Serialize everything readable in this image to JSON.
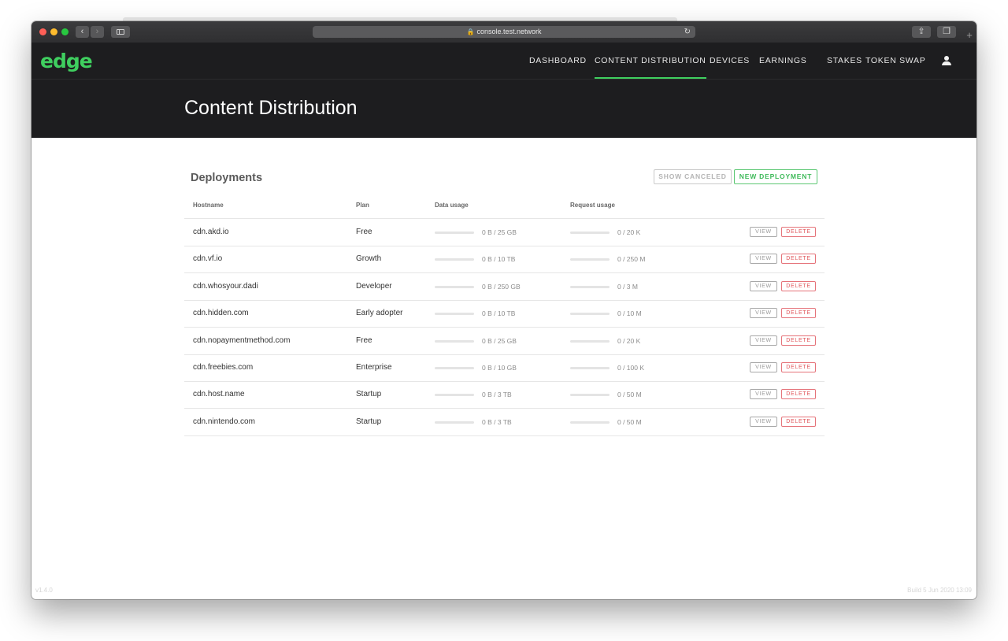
{
  "browser": {
    "url": "console.test.network",
    "back_glyph": "‹",
    "forward_glyph": "›",
    "share_glyph": "⇪",
    "tabs_glyph": "❐",
    "plus_glyph": "+",
    "reload_glyph": "↻",
    "lock_glyph": "🔒"
  },
  "app": {
    "logo": "edge",
    "accent_color": "#3fcf5f",
    "nav": [
      {
        "label": "DASHBOARD",
        "active": false
      },
      {
        "label": "CONTENT DISTRIBUTION",
        "active": true
      },
      {
        "label": "DEVICES",
        "active": false
      },
      {
        "label": "EARNINGS",
        "active": false
      },
      {
        "label": "STAKES",
        "active": false
      },
      {
        "label": "TOKEN SWAP",
        "active": false
      }
    ],
    "user_icon": "user-icon"
  },
  "page": {
    "title": "Content Distribution",
    "section_title": "Deployments",
    "show_canceled_label": "SHOW CANCELED",
    "new_deployment_label": "NEW DEPLOYMENT"
  },
  "table": {
    "columns": [
      "Hostname",
      "Plan",
      "Data usage",
      "Request usage"
    ],
    "view_label": "VIEW",
    "delete_label": "DELETE",
    "rows": [
      {
        "hostname": "cdn.akd.io",
        "plan": "Free",
        "data_usage": "0 B / 25 GB",
        "request_usage": "0 / 20 K",
        "data_fraction": 0,
        "request_fraction": 0
      },
      {
        "hostname": "cdn.vf.io",
        "plan": "Growth",
        "data_usage": "0 B / 10 TB",
        "request_usage": "0 / 250 M",
        "data_fraction": 0,
        "request_fraction": 0
      },
      {
        "hostname": "cdn.whosyour.dadi",
        "plan": "Developer",
        "data_usage": "0 B / 250 GB",
        "request_usage": "0 / 3 M",
        "data_fraction": 0,
        "request_fraction": 0
      },
      {
        "hostname": "cdn.hidden.com",
        "plan": "Early adopter",
        "data_usage": "0 B / 10 TB",
        "request_usage": "0 / 10 M",
        "data_fraction": 0,
        "request_fraction": 0
      },
      {
        "hostname": "cdn.nopaymentmethod.com",
        "plan": "Free",
        "data_usage": "0 B / 25 GB",
        "request_usage": "0 / 20 K",
        "data_fraction": 0,
        "request_fraction": 0
      },
      {
        "hostname": "cdn.freebies.com",
        "plan": "Enterprise",
        "data_usage": "0 B / 10 GB",
        "request_usage": "0 / 100 K",
        "data_fraction": 0,
        "request_fraction": 0
      },
      {
        "hostname": "cdn.host.name",
        "plan": "Startup",
        "data_usage": "0 B / 3 TB",
        "request_usage": "0 / 50 M",
        "data_fraction": 0,
        "request_fraction": 0
      },
      {
        "hostname": "cdn.nintendo.com",
        "plan": "Startup",
        "data_usage": "0 B / 3 TB",
        "request_usage": "0 / 50 M",
        "data_fraction": 0,
        "request_fraction": 0
      }
    ]
  },
  "footer": {
    "version": "v1.4.0",
    "build": "Build 5 Jun 2020 13:09"
  }
}
